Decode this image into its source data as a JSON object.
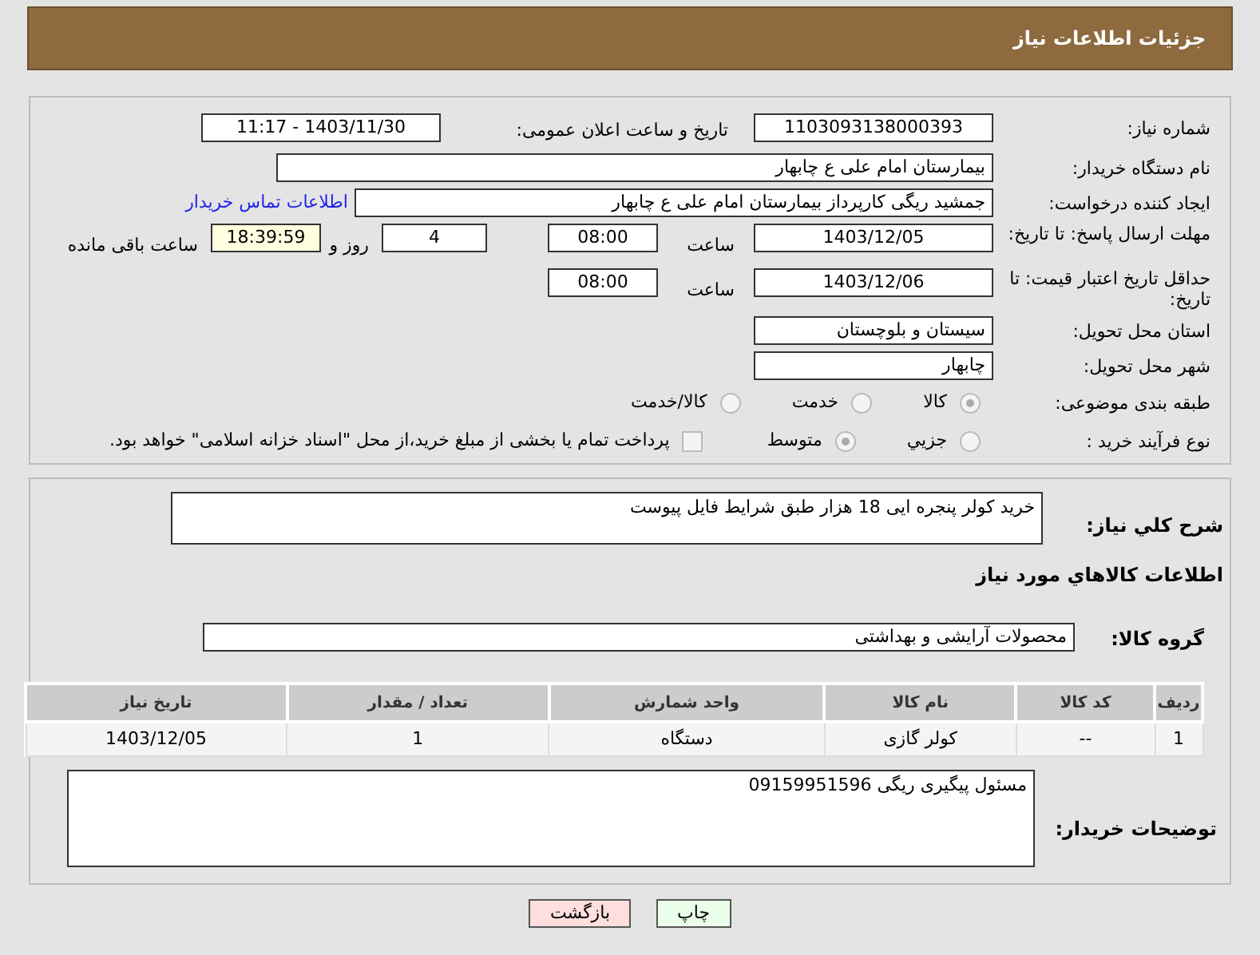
{
  "header": {
    "title": "جزئیات اطلاعات نیاز"
  },
  "need_number": {
    "label": "شماره نیاز:",
    "value": "1103093138000393"
  },
  "announce": {
    "label": "تاریخ و ساعت اعلان عمومی:",
    "value": "1403/11/30 - 11:17"
  },
  "buyer_org": {
    "label": "نام دستگاه خریدار:",
    "value": "بیمارستان امام علی  ع  چابهار"
  },
  "creator": {
    "label": "ایجاد کننده درخواست:",
    "value": "جمشید ریگی کارپرداز بیمارستان امام علی  ع  چابهار",
    "link": "اطلاعات تماس خریدار"
  },
  "deadline": {
    "label": "مهلت ارسال پاسخ: تا تاریخ:",
    "date": "1403/12/05",
    "time_label": "ساعت",
    "time": "08:00",
    "days": "4",
    "days_label": "روز و",
    "remaining": "18:39:59",
    "remaining_label": "ساعت باقی مانده"
  },
  "validity": {
    "label": "حداقل تاریخ اعتبار قیمت: تا تاریخ:",
    "date": "1403/12/06",
    "time_label": "ساعت",
    "time": "08:00"
  },
  "province": {
    "label": "استان محل تحویل:",
    "value": "سیستان و بلوچستان"
  },
  "city": {
    "label": "شهر محل تحویل:",
    "value": "چابهار"
  },
  "category": {
    "label": "طبقه بندی موضوعی:",
    "options": [
      {
        "label": "کالا",
        "selected": true
      },
      {
        "label": "خدمت",
        "selected": false
      },
      {
        "label": "کالا/خدمت",
        "selected": false
      }
    ]
  },
  "process": {
    "label": "نوع فرآیند خرید :",
    "options": [
      {
        "label": "جزیي",
        "selected": false
      },
      {
        "label": "متوسط",
        "selected": true
      }
    ],
    "note": {
      "checked": false,
      "text": "پرداخت تمام یا بخشی از مبلغ خرید،از محل \"اسناد خزانه اسلامی\" خواهد بود."
    }
  },
  "description": {
    "label": "شرح کلي نياز:",
    "value": "خرید کولر پنجره ایی 18 هزار طبق شرایط فایل پیوست"
  },
  "goods_title": "اطلاعات کالاهاي مورد نياز",
  "group": {
    "label": "گروه کالا:",
    "value": "محصولات آرایشی و بهداشتی"
  },
  "table": {
    "columns": [
      "ردیف",
      "کد کالا",
      "نام کالا",
      "واحد شمارش",
      "تعداد / مقدار",
      "تاریخ نیاز"
    ],
    "rows": [
      [
        "1",
        "--",
        "کولر گازی",
        "دستگاه",
        "1",
        "1403/12/05"
      ]
    ]
  },
  "buyer_notes": {
    "label": "توضیحات خریدار:",
    "value": "مسئول پیگیری ریگی 09159951596"
  },
  "buttons": [
    {
      "label": "چاپ",
      "kind": "print"
    },
    {
      "label": "بازگشت",
      "kind": "back"
    }
  ]
}
